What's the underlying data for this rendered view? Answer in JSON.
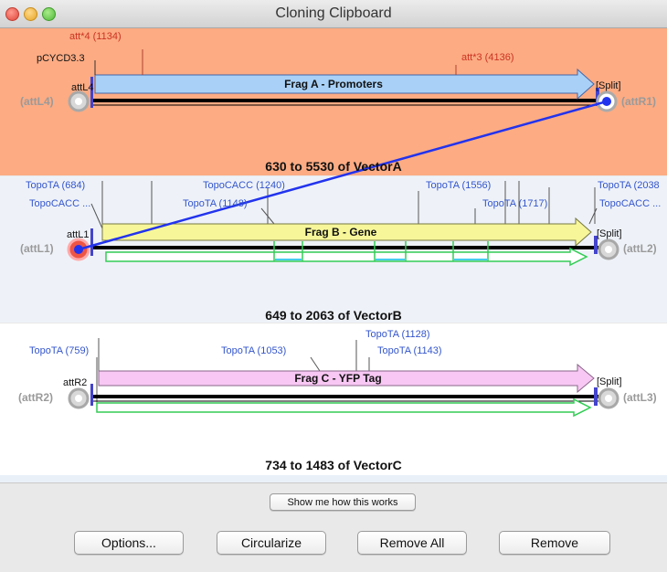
{
  "window": {
    "title": "Cloning Clipboard"
  },
  "panelA": {
    "range": "630 to 5530 of VectorA",
    "fragment": "Frag A - Promoters",
    "vector_label": "pCYCD3.3",
    "left_site": "attL4",
    "left_end": "(attL4)",
    "right_end": "(attR1)",
    "split": "[Split]",
    "features": [
      "att*4 (1134)",
      "att*3 (4136)"
    ]
  },
  "panelB": {
    "range": "649 to 2063 of VectorB",
    "fragment": "Frag B - Gene",
    "left_site": "attL1",
    "left_end": "(attL1)",
    "right_end": "(attL2)",
    "split": "[Split]",
    "features": [
      "TopoTA (684)",
      "TopoCACC ...",
      "TopoCACC (1240)",
      "TopoTA (1148)",
      "TopoTA (1556)",
      "TopoTA (1717)",
      "TopoTA (2038",
      "TopoCACC ..."
    ]
  },
  "panelC": {
    "range": "734 to 1483 of VectorC",
    "fragment": "Frag C - YFP Tag",
    "left_site": "attR2",
    "left_end": "(attR2)",
    "right_end": "(attL3)",
    "split": "[Split]",
    "features": [
      "TopoTA (759)",
      "TopoTA (1053)",
      "TopoTA (1128)",
      "TopoTA (1143)"
    ]
  },
  "help_button": "Show me how this works",
  "buttons": {
    "options": "Options...",
    "circularize": "Circularize",
    "remove_all": "Remove All",
    "remove": "Remove"
  },
  "colors": {
    "panelA": "#fcab83",
    "panelB": "#eef2f8",
    "fragA": "#a9d1f7",
    "fragB": "#f7f79a",
    "fragC": "#f8c7f3",
    "link": "#2233ee"
  }
}
